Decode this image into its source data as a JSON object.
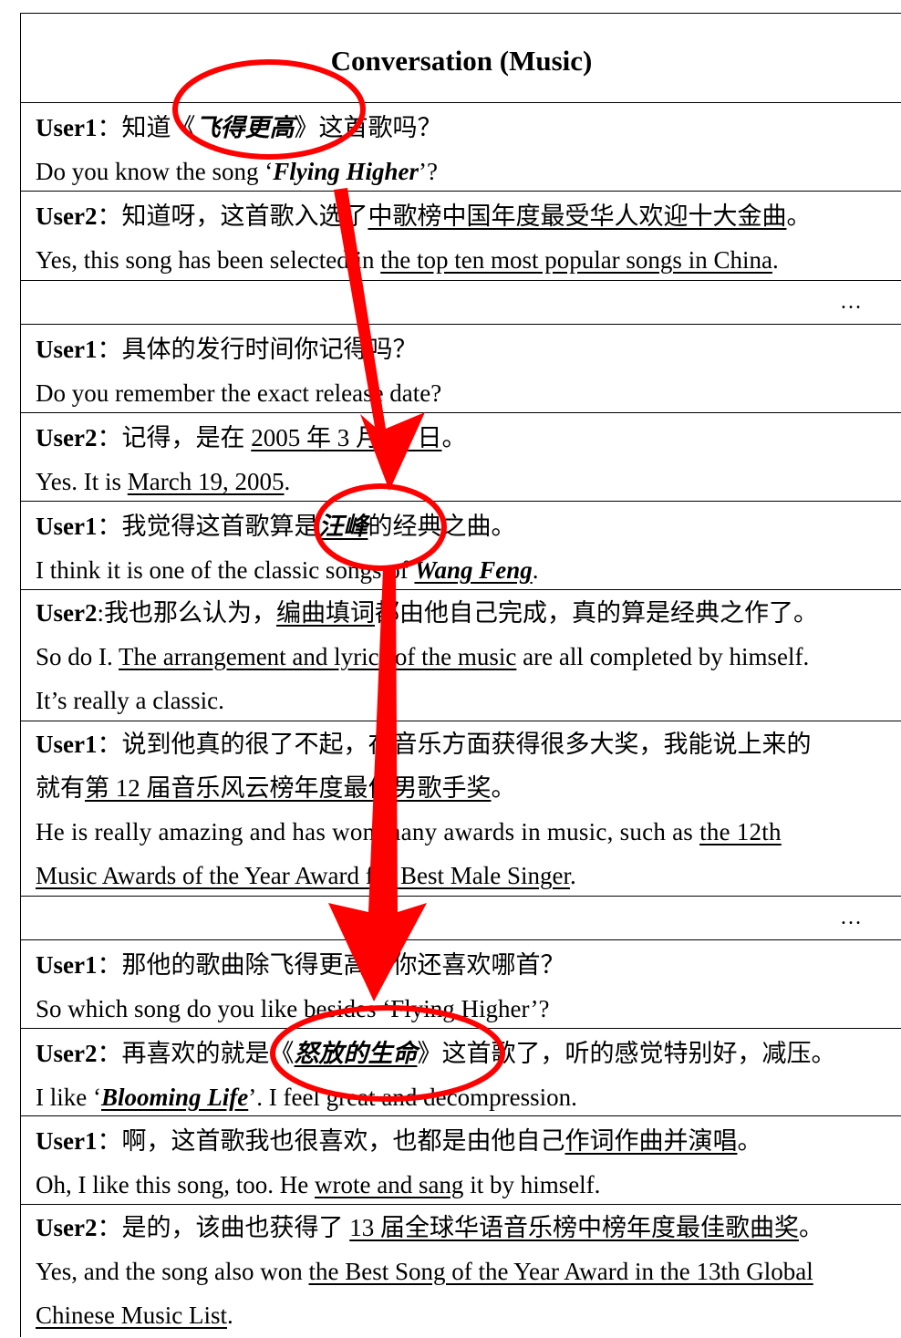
{
  "title": "Conversation (Music)",
  "ellipsis": "…",
  "turns": [
    {
      "speaker": "User1",
      "zh": [
        "：知道《",
        "飞得更高",
        "》这首歌吗？"
      ],
      "en": [
        "Do you know the song ‘",
        "Flying Higher",
        "’?"
      ]
    },
    {
      "speaker": "User2",
      "zh": [
        "：知道呀，这首歌入选了",
        "中歌榜中国年度最受华人欢迎十大金曲",
        "。"
      ],
      "en": [
        "Yes, this song has been selected in ",
        "the top ten most popular songs in China",
        "."
      ]
    },
    {
      "speaker": "User1",
      "zh": [
        "：具体的发行时间你记得吗？"
      ],
      "en": [
        "Do you remember the exact release date?"
      ]
    },
    {
      "speaker": "User2",
      "zh": [
        "：记得，是在 ",
        "2005 年 3 月 19 日",
        "。"
      ],
      "en": [
        "Yes. It is ",
        "March 19, 2005",
        "."
      ]
    },
    {
      "speaker": "User1",
      "zh": [
        "：我觉得这首歌算是",
        "汪峰",
        "的经典之曲。"
      ],
      "en": [
        "I think it is one of the classic songs of ",
        "Wang Feng",
        "."
      ]
    },
    {
      "speaker": "User2",
      "zh": [
        ":我也那么认为，",
        "编曲填词",
        "都由他自己完成，真的算是经典之作了。"
      ],
      "en": [
        "So do I. ",
        "The arrangement and lyrics of the music",
        " are all completed by himself."
      ],
      "en2": "It’s really a classic."
    },
    {
      "speaker": "User1",
      "zh": [
        "：说到他真的很了不起，在音乐方面获得很多大奖，我能说上来的"
      ],
      "zh2": [
        "就有",
        "第 12 届音乐风云榜年度最佳男歌手奖",
        "。"
      ],
      "en": [
        "He is really amazing and has won many awards in music, such as ",
        "the 12th"
      ],
      "en2": [
        "Music Awards of the Year Award for Best Male Singer",
        "."
      ]
    },
    {
      "speaker": "User1",
      "zh": [
        "：那他的歌曲除飞得更高，你还喜欢哪首？"
      ],
      "en": [
        "So which song do you like besides ‘Flying Higher’?"
      ]
    },
    {
      "speaker": "User2",
      "zh": [
        "：再喜欢的就是《",
        "怒放的生命",
        "》这首歌了，听的感觉特别好，减压。"
      ],
      "en": [
        "I like ‘",
        "Blooming Life",
        "’. I feel great and decompression."
      ]
    },
    {
      "speaker": "User1",
      "zh": [
        "：啊，这首歌我也很喜欢，也都是由他自己",
        "作词作曲并演唱",
        "。"
      ],
      "en": [
        "Oh, I like this song, too. He ",
        "wrote and sang",
        " it by himself."
      ]
    },
    {
      "speaker": "User2",
      "zh": [
        "：是的，该曲也获得了 ",
        "13 届全球华语音乐榜中榜年度最佳歌曲奖",
        "。"
      ],
      "en": [
        "Yes, and the song also won ",
        "the Best Song of the Year Award in the 13th Global"
      ],
      "en2": [
        "Chinese Music List",
        "."
      ]
    }
  ],
  "colors": {
    "annotation": "#ff0000",
    "border": "#000000"
  }
}
